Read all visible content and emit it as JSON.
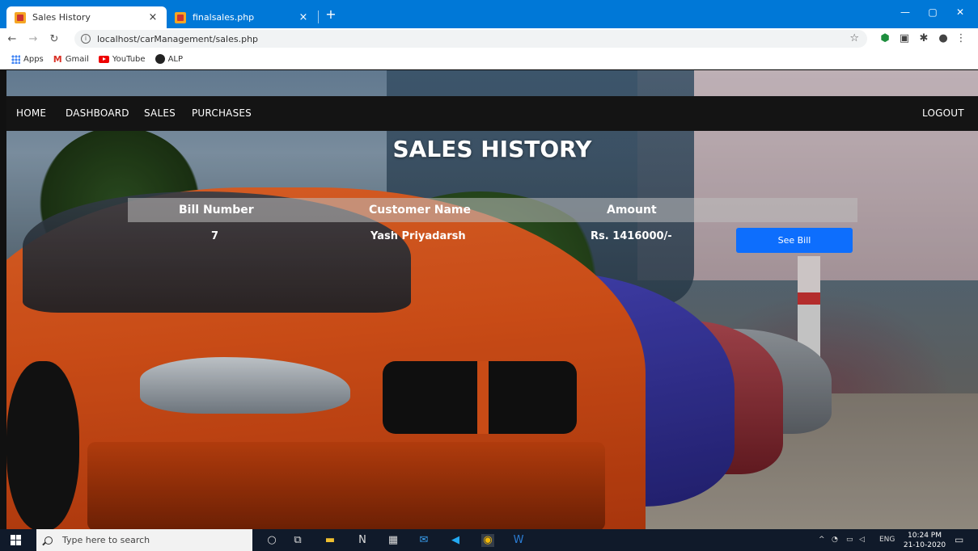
{
  "browser": {
    "tabs": [
      {
        "title": "Sales History",
        "close": "×"
      },
      {
        "title": "finalsales.php",
        "close": "×"
      }
    ],
    "new_tab": "+",
    "url": "localhost/carManagement/sales.php",
    "bookmarks": [
      "Apps",
      "Gmail",
      "YouTube",
      "ALP"
    ]
  },
  "nav": {
    "links": [
      "HOME",
      "DASHBOARD",
      "SALES",
      "PURCHASES"
    ],
    "logout": "LOGOUT"
  },
  "page": {
    "title": "SALES HISTORY"
  },
  "table": {
    "headers": [
      "Bill Number",
      "Customer Name",
      "Amount"
    ],
    "rows": [
      {
        "bill_number": "7",
        "customer_name": "Yash Priyadarsh",
        "amount": "Rs. 1416000/-",
        "action": "See Bill"
      }
    ]
  },
  "taskbar": {
    "search_placeholder": "Type here to search",
    "lang": "ENG",
    "time": "10:24 PM",
    "date": "21-10-2020"
  }
}
